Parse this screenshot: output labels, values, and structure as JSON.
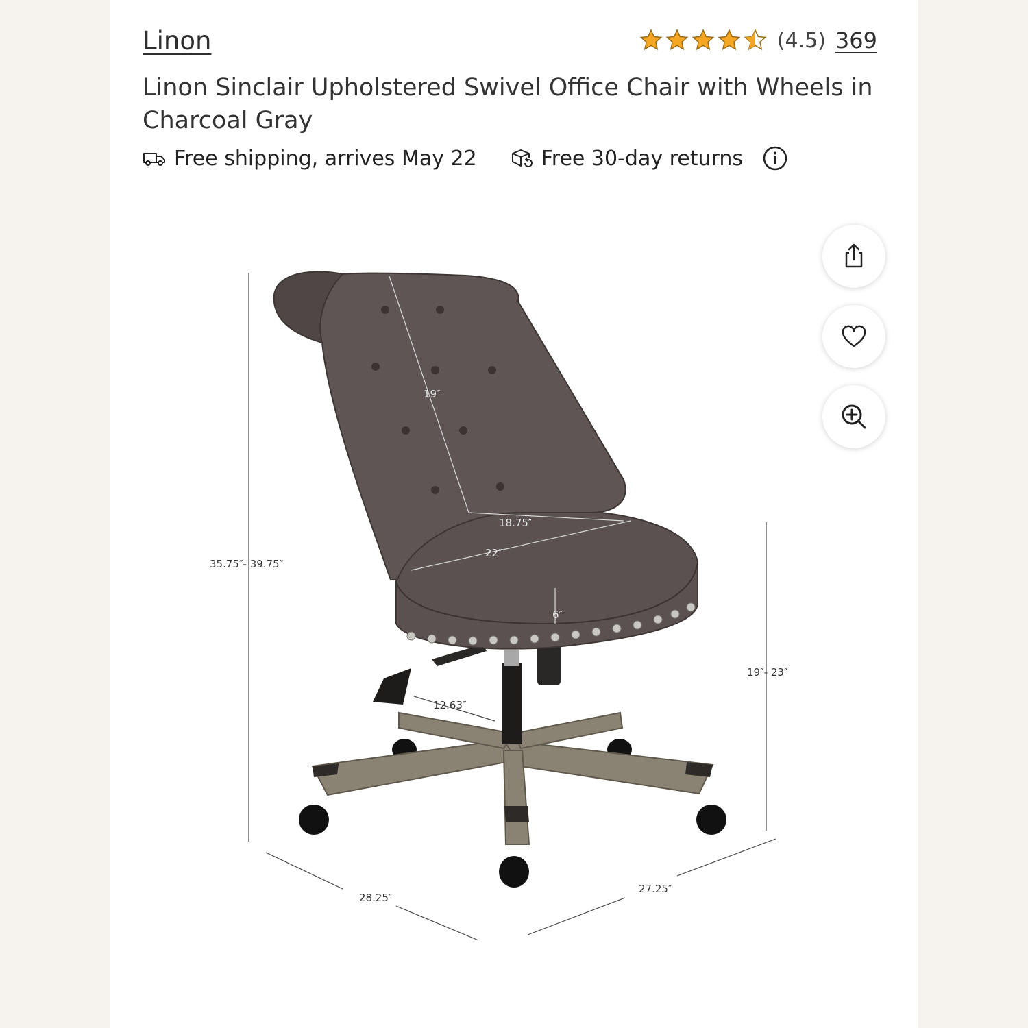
{
  "brand": "Linon",
  "rating": {
    "stars": 4.5,
    "value_text": "(4.5)",
    "review_count": "369",
    "star_color": "#f5a623"
  },
  "product": {
    "title": "Linon Sinclair Upholstered Swivel Office Chair with Wheels in Charcoal Gray"
  },
  "perks": [
    {
      "icon": "truck-icon",
      "label": "Free shipping, arrives May 22"
    },
    {
      "icon": "return-box-icon",
      "label": "Free 30-day returns"
    }
  ],
  "actions": [
    {
      "icon": "share-icon"
    },
    {
      "icon": "heart-icon"
    },
    {
      "icon": "zoom-in-icon"
    }
  ],
  "image": {
    "dimensions": {
      "back_height": "19″",
      "seat_depth": "18.75″",
      "seat_width": "22″",
      "seat_thickness": "6″",
      "overall_height": "35.75″- 39.75″",
      "seat_height": "19″- 23″",
      "base_spoke": "12.63″",
      "depth": "28.25″",
      "width": "27.25″"
    }
  }
}
